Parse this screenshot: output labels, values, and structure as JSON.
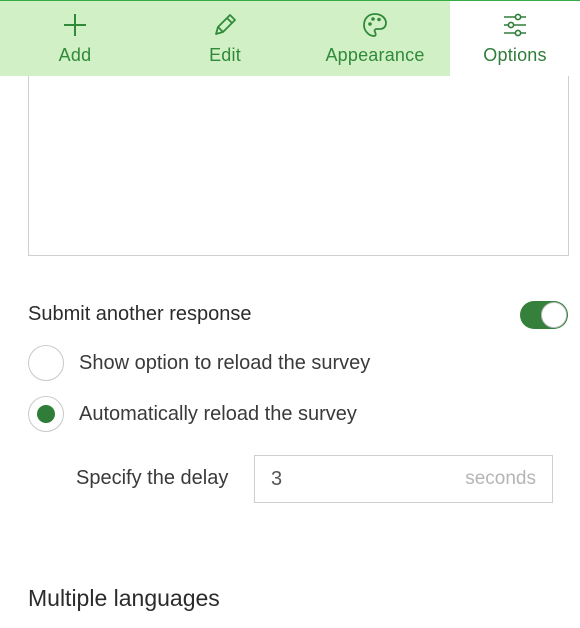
{
  "tabs": [
    {
      "label": "Add",
      "icon": "plus-icon"
    },
    {
      "label": "Edit",
      "icon": "pencil-icon"
    },
    {
      "label": "Appearance",
      "icon": "palette-icon"
    },
    {
      "label": "Options",
      "icon": "sliders-icon",
      "active": true
    }
  ],
  "colors": {
    "accent": "#2f7d38",
    "tab_bg": "#d2f0c5",
    "toggle_on": "#35803a"
  },
  "submit_another": {
    "label": "Submit another response",
    "enabled": true,
    "options": [
      {
        "label": "Show option to reload the survey",
        "selected": false
      },
      {
        "label": "Automatically reload the survey",
        "selected": true
      }
    ],
    "delay": {
      "label": "Specify the delay",
      "value": "3",
      "unit": "seconds"
    }
  },
  "multiple_languages": {
    "heading": "Multiple languages"
  }
}
